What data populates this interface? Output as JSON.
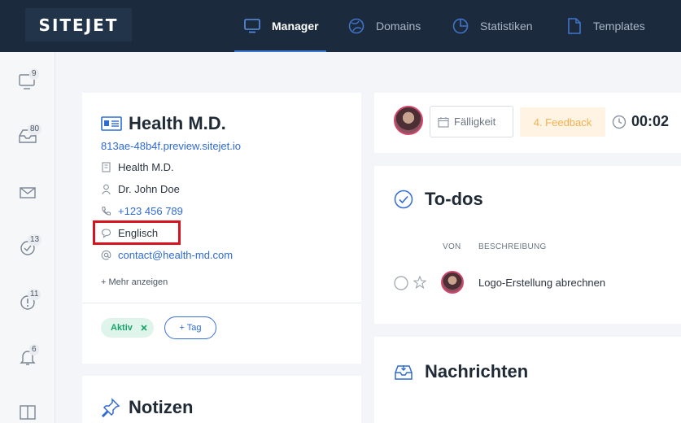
{
  "app": {
    "logo": "SITEJET"
  },
  "nav": {
    "items": [
      {
        "label": "Manager",
        "icon": "monitor-icon",
        "active": true
      },
      {
        "label": "Domains",
        "icon": "globe-icon",
        "active": false
      },
      {
        "label": "Statistiken",
        "icon": "pie-chart-icon",
        "active": false
      },
      {
        "label": "Templates",
        "icon": "document-icon",
        "active": false
      }
    ]
  },
  "sidebar": {
    "items": [
      {
        "icon": "monitor-icon",
        "badge": "9"
      },
      {
        "icon": "inbox-icon",
        "badge": "80"
      },
      {
        "icon": "mail-icon",
        "badge": ""
      },
      {
        "icon": "check-clock-icon",
        "badge": "13"
      },
      {
        "icon": "alert-clock-icon",
        "badge": "11"
      },
      {
        "icon": "bell-icon",
        "badge": "6"
      },
      {
        "icon": "columns-icon",
        "badge": ""
      }
    ]
  },
  "contact": {
    "title": "Health M.D.",
    "url": "813ae-48b4f.preview.sitejet.io",
    "company": "Health M.D.",
    "person": "Dr. John Doe",
    "phone": "+123 456 789",
    "language": "Englisch",
    "email": "contact@health-md.com",
    "more_label": "+ Mehr anzeigen",
    "tag_active": "Aktiv",
    "tag_add_label": "+ Tag"
  },
  "notes": {
    "title": "Notizen"
  },
  "toolbar": {
    "due_label": "Fälligkeit",
    "status_label": "4. Feedback",
    "timer": "00:02"
  },
  "todos": {
    "title": "To-dos",
    "columns": {
      "von": "VON",
      "beschreibung": "BESCHREIBUNG"
    },
    "items": [
      {
        "text": "Logo-Erstellung abrechnen"
      }
    ]
  },
  "messages": {
    "title": "Nachrichten"
  },
  "colors": {
    "nav_bg": "#1c2a3e",
    "accent": "#2f6bd1",
    "highlight": "#d6141f",
    "status_bg": "#fff4e3",
    "status_text": "#f2b04f",
    "tag_green": "#19a36b"
  }
}
